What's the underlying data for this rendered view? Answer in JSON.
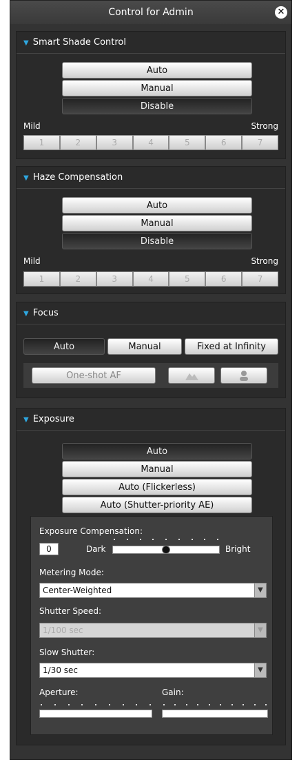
{
  "window": {
    "title": "Control for Admin"
  },
  "smart_shade": {
    "title": "Smart Shade Control",
    "modes": [
      "Auto",
      "Manual",
      "Disable"
    ],
    "selected_mode": "Disable",
    "mild_label": "Mild",
    "strong_label": "Strong",
    "levels": [
      "1",
      "2",
      "3",
      "4",
      "5",
      "6",
      "7"
    ]
  },
  "haze": {
    "title": "Haze Compensation",
    "modes": [
      "Auto",
      "Manual",
      "Disable"
    ],
    "selected_mode": "Disable",
    "mild_label": "Mild",
    "strong_label": "Strong",
    "levels": [
      "1",
      "2",
      "3",
      "4",
      "5",
      "6",
      "7"
    ]
  },
  "focus": {
    "title": "Focus",
    "modes": [
      "Auto",
      "Manual",
      "Fixed at Infinity"
    ],
    "selected_mode": "Auto",
    "oneshot_label": "One-shot AF"
  },
  "exposure": {
    "title": "Exposure",
    "modes": [
      "Auto",
      "Manual",
      "Auto (Flickerless)",
      "Auto (Shutter-priority AE)"
    ],
    "selected_mode": "Auto",
    "compensation": {
      "label": "Exposure Compensation:",
      "value": "0",
      "dark_label": "Dark",
      "bright_label": "Bright",
      "level_fraction": 0.5
    },
    "metering": {
      "label": "Metering Mode:",
      "value": "Center-Weighted"
    },
    "shutter_speed": {
      "label": "Shutter Speed:",
      "value": "1/100 sec"
    },
    "slow_shutter": {
      "label": "Slow Shutter:",
      "value": "1/30 sec"
    },
    "aperture": {
      "label": "Aperture:"
    },
    "gain": {
      "label": "Gain:"
    }
  },
  "colors": {
    "accent": "#2ea7e0",
    "panel_bg": "#2a2a2a"
  }
}
